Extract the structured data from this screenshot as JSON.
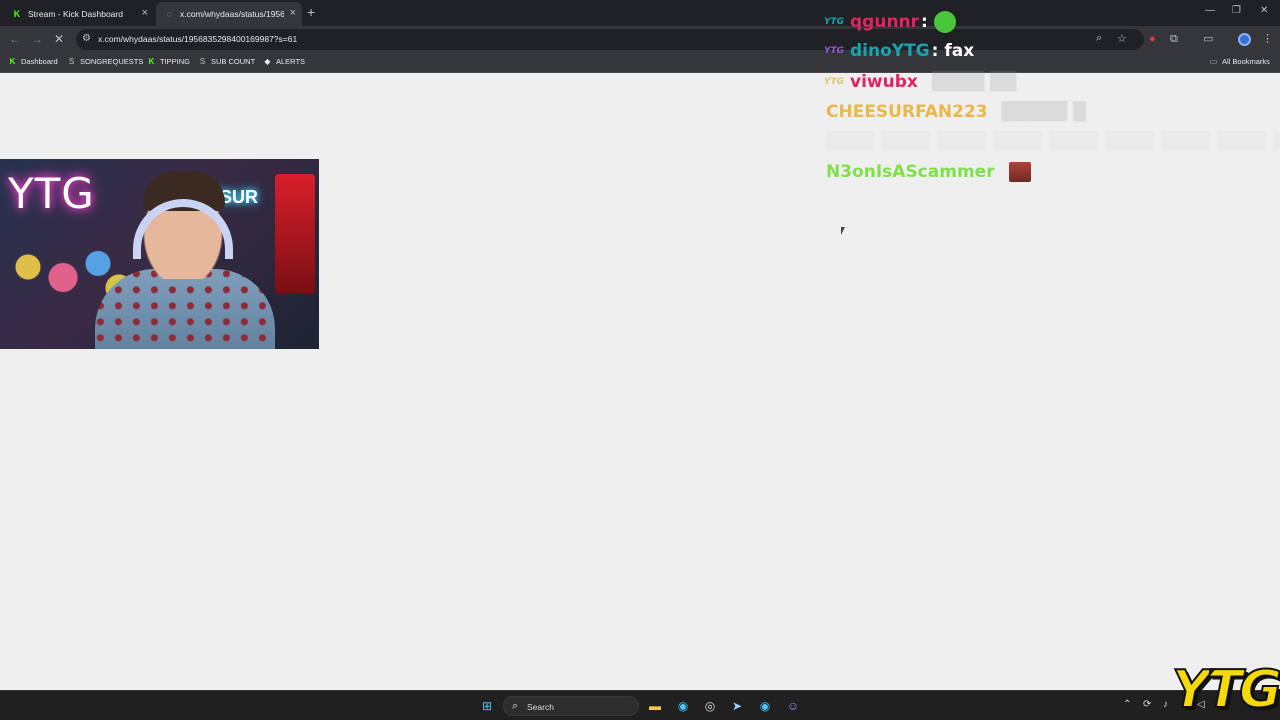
{
  "browser": {
    "tabs": [
      {
        "title": "Stream - Kick Dashboard",
        "favicon": "kick-icon",
        "active": false
      },
      {
        "title": "x.com/whydaas/status/195683",
        "favicon": "loading-icon",
        "active": true
      }
    ],
    "url": "x.com/whydaas/status/1956835298400169987?s=61",
    "bookmarks": [
      {
        "label": "Dashboard",
        "icon": "kick-icon"
      },
      {
        "label": "SONGREQUESTS",
        "icon": "streamelements-icon"
      },
      {
        "label": "TIPPING",
        "icon": "kick-icon"
      },
      {
        "label": "SUB COUNT",
        "icon": "streamelements-icon"
      },
      {
        "label": "ALERTS",
        "icon": "diamond-icon"
      }
    ],
    "all_bookmarks": "All Bookmarks"
  },
  "chat": {
    "messages": [
      {
        "badge": "YTG",
        "user": "qgunnr",
        "text": ":",
        "color": "#e0245e"
      },
      {
        "badge": "YTG",
        "user": "dinoYTG",
        "text": ": fax",
        "color": "#1aa3b0"
      },
      {
        "badge": "YTG",
        "user": "viwubx",
        "text": "",
        "color": "#e0245e"
      },
      {
        "badge": "",
        "user": "CHEESURFAN223",
        "text": "",
        "color": "#e9b84a"
      },
      {
        "badge": "",
        "user": "N3onIsAScammer",
        "text": "",
        "color": "#7fe04a"
      }
    ]
  },
  "webcam": {
    "neon_sign": "YTG",
    "neon_sign_2": "ESUR"
  },
  "taskbar": {
    "search_label": "Search"
  },
  "overlay_logo": "YTG",
  "colors": {
    "accent_kick": "#53fc18",
    "chrome_dark": "#202124",
    "chrome_mid": "#35363a"
  }
}
